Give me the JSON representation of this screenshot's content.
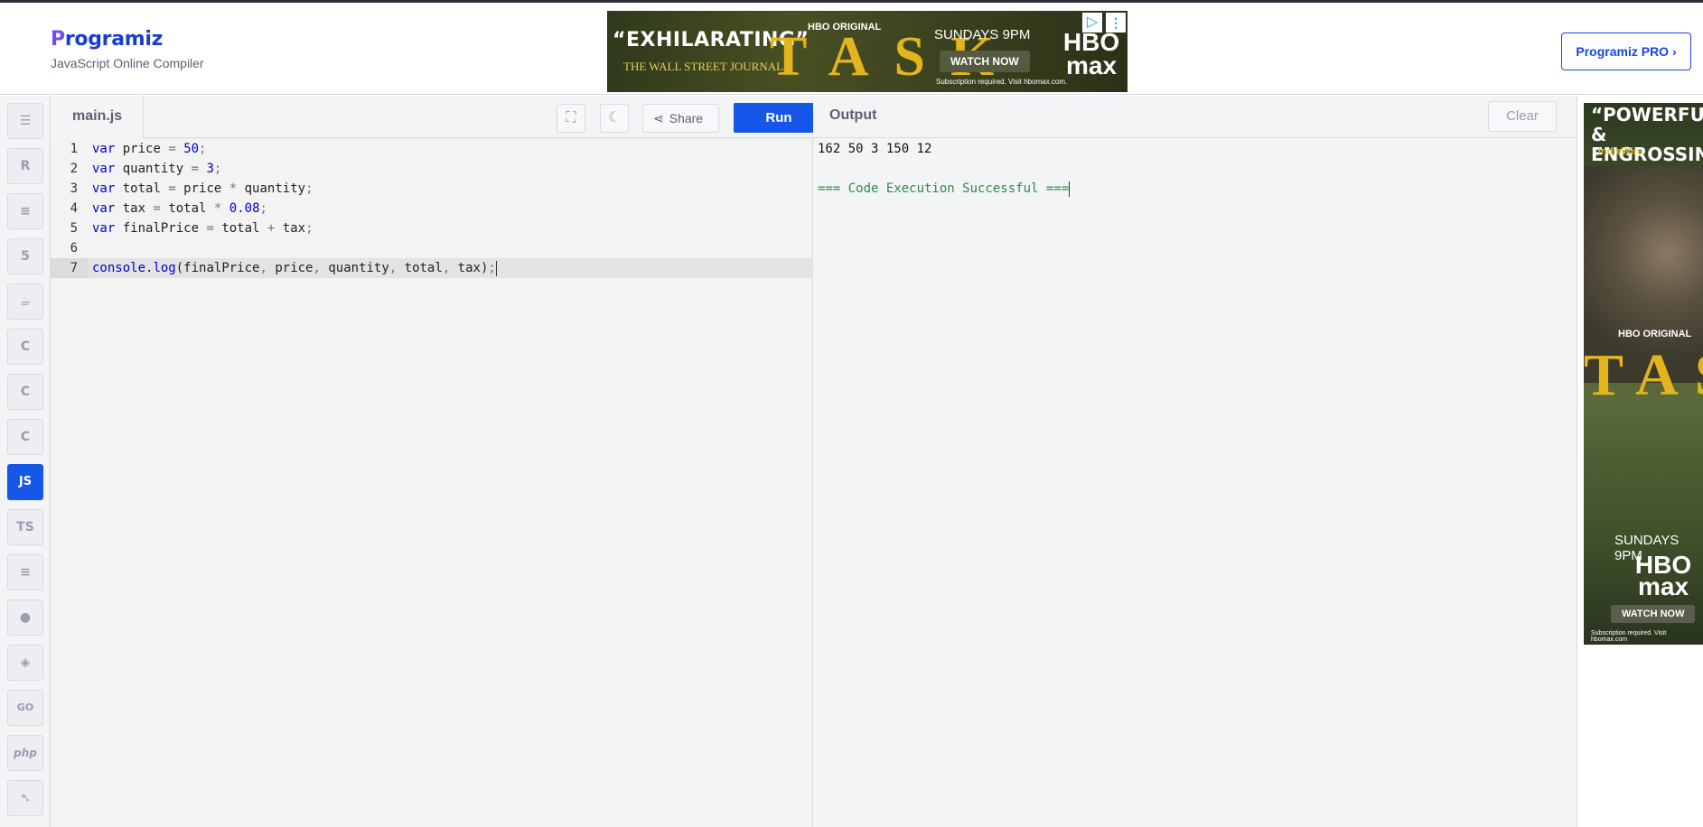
{
  "header": {
    "logo_text": "rogramiz",
    "logo_initial": "P",
    "subtitle": "JavaScript Online Compiler",
    "pro_button": "Programiz PRO ›"
  },
  "ad_top": {
    "quote": "“EXHILARATING”",
    "source": "THE WALL STREET JOURNAL.",
    "show": "TASK",
    "network": "HBO ORIGINAL",
    "schedule": "SUNDAYS 9PM",
    "cta": "WATCH NOW",
    "brand": "HBO max",
    "fineprint": "Subscription required. Visit hbomax.com."
  },
  "sidebar": {
    "languages": [
      {
        "name": "python",
        "glyph": "☰"
      },
      {
        "name": "r",
        "glyph": "R"
      },
      {
        "name": "sql",
        "glyph": "≡"
      },
      {
        "name": "html",
        "glyph": "5"
      },
      {
        "name": "java",
        "glyph": "☕"
      },
      {
        "name": "c",
        "glyph": "C"
      },
      {
        "name": "cpp",
        "glyph": "C"
      },
      {
        "name": "csharp",
        "glyph": "C"
      },
      {
        "name": "js",
        "glyph": "JS"
      },
      {
        "name": "ts",
        "glyph": "TS"
      },
      {
        "name": "kotlin",
        "glyph": "≡"
      },
      {
        "name": "rust",
        "glyph": "●"
      },
      {
        "name": "dart",
        "glyph": "◈"
      },
      {
        "name": "go",
        "glyph": "GO"
      },
      {
        "name": "php",
        "glyph": "php"
      },
      {
        "name": "swift",
        "glyph": "➴"
      }
    ]
  },
  "editor": {
    "file_name": "main.js",
    "share_label": "Share",
    "run_label": "Run",
    "lines": [
      {
        "n": "1",
        "text": "var price = 50;"
      },
      {
        "n": "2",
        "text": "var quantity = 3;"
      },
      {
        "n": "3",
        "text": "var total = price * quantity;"
      },
      {
        "n": "4",
        "text": "var tax = total * 0.08;"
      },
      {
        "n": "5",
        "text": "var finalPrice = total + tax;"
      },
      {
        "n": "6",
        "text": ""
      },
      {
        "n": "7",
        "text": "console.log(finalPrice, price, quantity, total, tax);"
      }
    ]
  },
  "output": {
    "title": "Output",
    "clear_label": "Clear",
    "result": "162 50 3 150 12",
    "status": "=== Code Execution Successful ==="
  },
  "ad_side": {
    "quote": "“POWERFUL & ENGROSSING”",
    "source": "IndieWire",
    "network": "HBO ORIGINAL",
    "show": "TASK",
    "schedule": "SUNDAYS 9PM",
    "brand": "HBO max",
    "cta": "WATCH NOW",
    "fineprint": "Subscription required. Visit hbomax.com"
  }
}
